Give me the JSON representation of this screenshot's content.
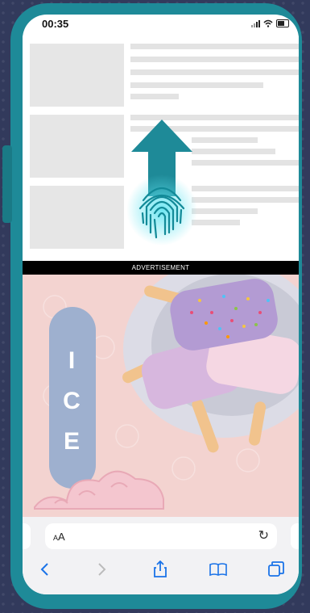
{
  "status_bar": {
    "time": "00:35"
  },
  "ad": {
    "label": "ADVERTISEMENT",
    "ice_letters": [
      "I",
      "C",
      "E"
    ],
    "brand_colors": {
      "background": "#f3d3d0",
      "pill": "#9eb0cf"
    }
  },
  "address_bar": {
    "text_size_label_small": "A",
    "text_size_label_large": "A",
    "reload_icon": "reload-icon"
  },
  "toolbar": {
    "icons": [
      "back-icon",
      "forward-icon",
      "share-icon",
      "bookmarks-icon",
      "tabs-icon"
    ]
  },
  "accent_color": "#1e8a98"
}
